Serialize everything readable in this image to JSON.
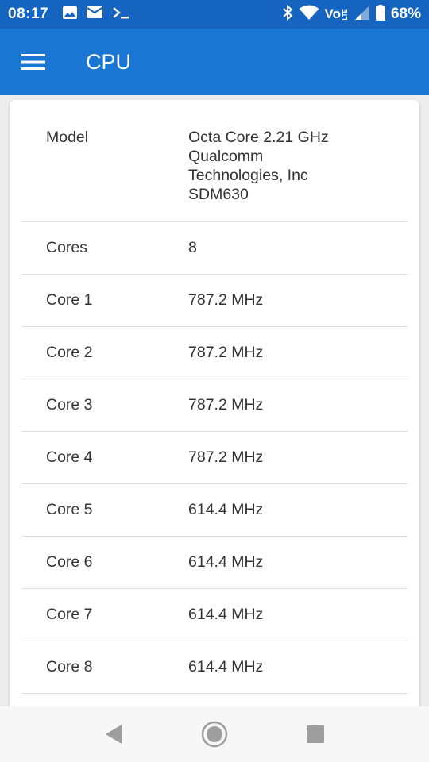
{
  "status_bar": {
    "time": "08:17",
    "volte_label": "Vo",
    "volte_sub": "LTE",
    "battery": "68%"
  },
  "app_bar": {
    "title": "CPU",
    "color": "#1976d2"
  },
  "rows": [
    {
      "key": "Model",
      "value": "Octa Core 2.21 GHz Qualcomm Technologies, Inc SDM630"
    },
    {
      "key": "Cores",
      "value": "8"
    },
    {
      "key": "Core 1",
      "value": "787.2 MHz"
    },
    {
      "key": "Core 2",
      "value": "787.2 MHz"
    },
    {
      "key": "Core 3",
      "value": "787.2 MHz"
    },
    {
      "key": "Core 4",
      "value": "787.2 MHz"
    },
    {
      "key": "Core 5",
      "value": "614.4 MHz"
    },
    {
      "key": "Core 6",
      "value": "614.4 MHz"
    },
    {
      "key": "Core 7",
      "value": "614.4 MHz"
    },
    {
      "key": "Core 8",
      "value": "614.4 MHz"
    }
  ],
  "icons": {
    "status": [
      "image-icon",
      "mail-icon",
      "terminal-icon",
      "bluetooth-icon",
      "wifi-icon",
      "signal-icon",
      "battery-icon"
    ],
    "nav": [
      "back-icon",
      "home-icon",
      "recents-icon"
    ]
  }
}
